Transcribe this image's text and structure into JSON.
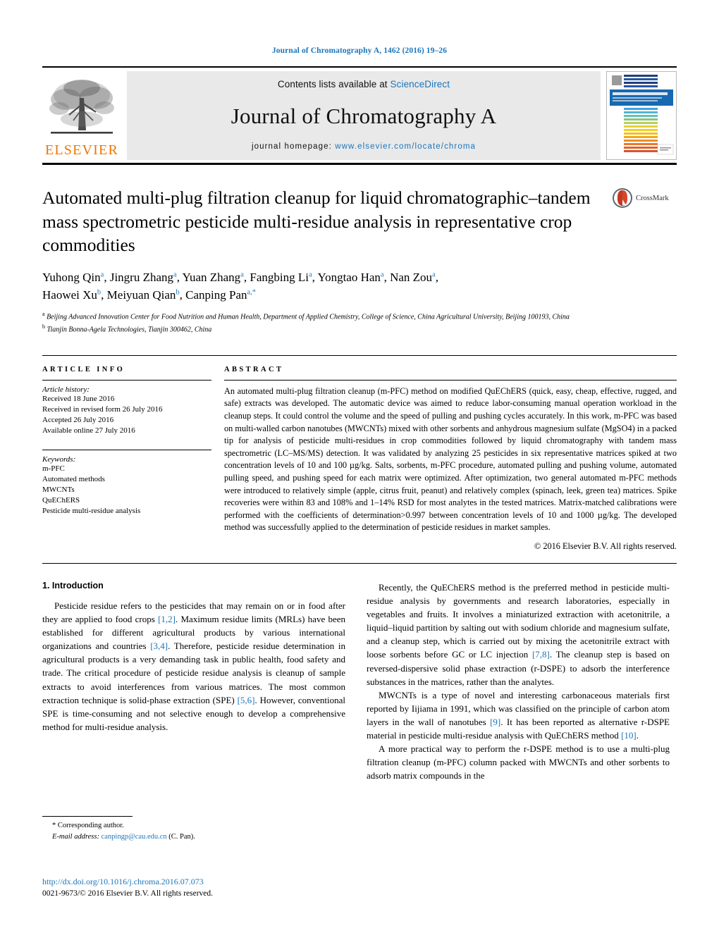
{
  "running_head": "Journal of Chromatography A, 1462 (2016) 19–26",
  "masthead": {
    "contents_prefix": "Contents lists available at ",
    "sciencedirect": "ScienceDirect",
    "journal_title": "Journal of Chromatography A",
    "homepage_prefix": "journal homepage: ",
    "homepage_url": "www.elsevier.com/locate/chroma",
    "publisher": "ELSEVIER",
    "cover_title": "JOURNAL OF CHROMATOGRAPHY A",
    "cover_subtitle": "INCLUDING ELECTROPHORESIS AND OTHER SEPARATION METHODS",
    "cover_publisher": "ELSEVIER"
  },
  "article": {
    "title": "Automated multi-plug filtration cleanup for liquid chromatographic–tandem mass spectrometric pesticide multi-residue analysis in representative crop commodities",
    "crossmark_label": "CrossMark",
    "authors_line1": "Yuhong Qin<sup>a</sup>, Jingru Zhang<sup>a</sup>, Yuan Zhang<sup>a</sup>, Fangbing Li<sup>a</sup>, Yongtao Han<sup>a</sup>, Nan Zou<sup>a</sup>,",
    "authors_line2": "Haowei Xu<sup>b</sup>, Meiyuan Qian<sup>b</sup>, Canping Pan<sup>a,*</sup>",
    "affiliation_a": "<sup>a</sup> Beijing Advanced Innovation Center for Food Nutrition and Human Health, Department of Applied Chemistry, College of Science, China Agricultural University, Beijing 100193, China",
    "affiliation_b": "<sup>b</sup> Tianjin Bonna-Agela Technologies, Tianjin 300462, China"
  },
  "article_info": {
    "heading": "ARTICLE INFO",
    "history_label": "Article history:",
    "history": [
      "Received 18 June 2016",
      "Received in revised form 26 July 2016",
      "Accepted 26 July 2016",
      "Available online 27 July 2016"
    ],
    "keywords_label": "Keywords:",
    "keywords": [
      "m-PFC",
      "Automated methods",
      "MWCNTs",
      "QuEChERS",
      "Pesticide multi-residue analysis"
    ]
  },
  "abstract": {
    "heading": "ABSTRACT",
    "text": "An automated multi-plug filtration cleanup (m-PFC) method on modified QuEChERS (quick, easy, cheap, effective, rugged, and safe) extracts was developed. The automatic device was aimed to reduce labor-consuming manual operation workload in the cleanup steps. It could control the volume and the speed of pulling and pushing cycles accurately. In this work, m-PFC was based on multi-walled carbon nanotubes (MWCNTs) mixed with other sorbents and anhydrous magnesium sulfate (MgSO4) in a packed tip for analysis of pesticide multi-residues in crop commodities followed by liquid chromatography with tandem mass spectrometric (LC–MS/MS) detection. It was validated by analyzing 25 pesticides in six representative matrices spiked at two concentration levels of 10 and 100 µg/kg. Salts, sorbents, m-PFC procedure, automated pulling and pushing volume, automated pulling speed, and pushing speed for each matrix were optimized. After optimization, two general automated m-PFC methods were introduced to relatively simple (apple, citrus fruit, peanut) and relatively complex (spinach, leek, green tea) matrices. Spike recoveries were within 83 and 108% and 1–14% RSD for most analytes in the tested matrices. Matrix-matched calibrations were performed with the coefficients of determination>0.997 between concentration levels of 10 and 1000 µg/kg. The developed method was successfully applied to the determination of pesticide residues in market samples.",
    "copyright": "© 2016 Elsevier B.V. All rights reserved."
  },
  "introduction": {
    "heading": "1.  Introduction",
    "left_paragraph": "Pesticide residue refers to the pesticides that may remain on or in food after they are applied to food crops <span class=\"ref\">[1,2]</span>. Maximum residue limits (MRLs) have been established for different agricultural products by various international organizations and countries <span class=\"ref\">[3,4]</span>. Therefore, pesticide residue determination in agricultural products is a very demanding task in public health, food safety and trade. The critical procedure of pesticide residue analysis is cleanup of sample extracts to avoid interferences from various matrices. The most common extraction technique is solid-phase extraction (SPE) <span class=\"ref\">[5,6]</span>. However, conventional SPE is time-consuming and not selective enough to develop a comprehensive method for multi-residue analysis.",
    "right_paragraph_1": "Recently, the QuEChERS method is the preferred method in pesticide multi-residue analysis by governments and research laboratories, especially in vegetables and fruits. It involves a miniaturized extraction with acetonitrile, a liquid–liquid partition by salting out with sodium chloride and magnesium sulfate, and a cleanup step, which is carried out by mixing the acetonitrile extract with loose sorbents before GC or LC injection <span class=\"ref\">[7,8]</span>. The cleanup step is based on reversed-dispersive solid phase extraction (r-DSPE) to adsorb the interference substances in the matrices, rather than the analytes.",
    "right_paragraph_2": "MWCNTs is a type of novel and interesting carbonaceous materials first reported by Iijiama in 1991, which was classified on the principle of carbon atom layers in the wall of nanotubes <span class=\"ref\">[9]</span>. It has been reported as alternative r-DSPE material in pesticide multi-residue analysis with QuEChERS method <span class=\"ref\">[10]</span>.",
    "right_paragraph_3": "A more practical way to perform the r-DSPE method is to use a multi-plug filtration cleanup (m-PFC) column packed with MWCNTs and other sorbents to adsorb matrix compounds in the"
  },
  "footnote": {
    "corresponding": "*  Corresponding author.",
    "email_label": "E-mail address: ",
    "email": "canpingp@cau.edu.cn",
    "email_suffix": " (C. Pan)."
  },
  "footer": {
    "doi": "http://dx.doi.org/10.1016/j.chroma.2016.07.073",
    "issn": "0021-9673/© 2016 Elsevier B.V. All rights reserved."
  },
  "colors": {
    "link_blue": "#1b75bb",
    "elsevier_orange": "#ee7600",
    "banner_gray": "#e9e9e9"
  }
}
